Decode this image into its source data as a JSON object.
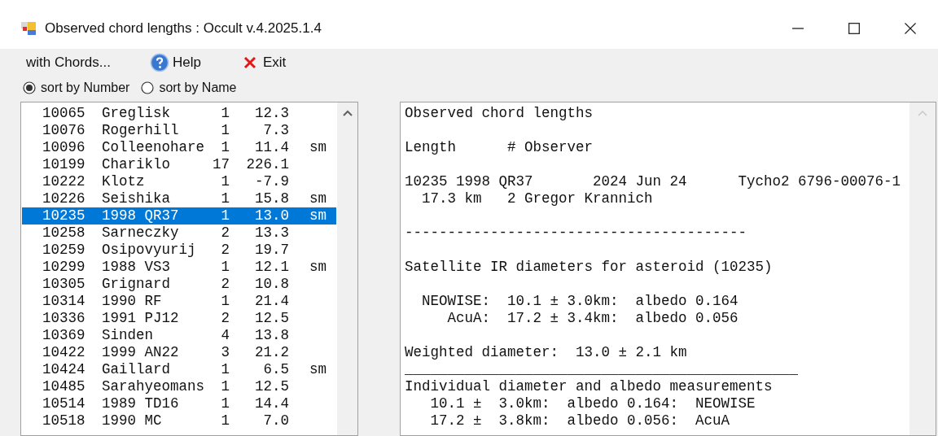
{
  "window": {
    "title": "Observed chord lengths : Occult v.4.2025.1.4"
  },
  "menu": [
    {
      "label": "with Chords...",
      "kind": "plain"
    },
    {
      "label": "Help",
      "kind": "help"
    },
    {
      "label": "Exit",
      "kind": "exit"
    }
  ],
  "sort_options": [
    {
      "label": "sort by Number",
      "selected": true
    },
    {
      "label": "sort by Name",
      "selected": false
    }
  ],
  "asteroid_list": [
    {
      "number": "10065",
      "name": "Greglisk",
      "count": "1",
      "value": "12.3",
      "selected": false
    },
    {
      "number": "10076",
      "name": "Rogerhill",
      "count": "1",
      "value": "7.3",
      "selected": false
    },
    {
      "number": "10096",
      "name": "Colleenohare",
      "count": "1",
      "value": "11.4",
      "flag": "sm",
      "selected": false
    },
    {
      "number": "10199",
      "name": "Chariklo",
      "count": "17",
      "value": "226.1",
      "selected": false
    },
    {
      "number": "10222",
      "name": "Klotz",
      "count": "1",
      "value": "-7.9",
      "selected": false
    },
    {
      "number": "10226",
      "name": "Seishika",
      "count": "1",
      "value": "15.8",
      "flag": "sm",
      "selected": false
    },
    {
      "number": "10235",
      "name": "1998 QR37",
      "count": "1",
      "value": "13.0",
      "flag": "sm",
      "selected": true
    },
    {
      "number": "10258",
      "name": "Sarneczky",
      "count": "2",
      "value": "13.3",
      "selected": false
    },
    {
      "number": "10259",
      "name": "Osipovyurij",
      "count": "2",
      "value": "19.7",
      "selected": false
    },
    {
      "number": "10299",
      "name": "1988 VS3",
      "count": "1",
      "value": "12.1",
      "flag": "sm",
      "selected": false
    },
    {
      "number": "10305",
      "name": "Grignard",
      "count": "2",
      "value": "10.8",
      "selected": false
    },
    {
      "number": "10314",
      "name": "1990 RF",
      "count": "1",
      "value": "21.4",
      "selected": false
    },
    {
      "number": "10336",
      "name": "1991 PJ12",
      "count": "2",
      "value": "12.5",
      "selected": false
    },
    {
      "number": "10369",
      "name": "Sinden",
      "count": "4",
      "value": "13.8",
      "selected": false
    },
    {
      "number": "10422",
      "name": "1999 AN22",
      "count": "3",
      "value": "21.2",
      "selected": false
    },
    {
      "number": "10424",
      "name": "Gaillard",
      "count": "1",
      "value": "6.5",
      "flag": "sm",
      "selected": false
    },
    {
      "number": "10485",
      "name": "Sarahyeomans",
      "count": "1",
      "value": "12.5",
      "selected": false
    },
    {
      "number": "10514",
      "name": "1989 TD16",
      "count": "1",
      "value": "14.4",
      "selected": false
    },
    {
      "number": "10518",
      "name": "1990 MC",
      "count": "1",
      "value": "7.0",
      "selected": false
    }
  ],
  "report": {
    "blocks": [
      [
        "Observed chord lengths"
      ],
      [
        "Length      # Observer"
      ],
      [
        "10235 1998 QR37       2024 Jun 24      Tycho2 6796-00076-1",
        "  17.3 km   2 Gregor Krannich"
      ],
      [
        "----------------------------------------"
      ],
      [
        "Satellite IR diameters for asteroid (10235)"
      ],
      [
        "  NEOWISE:  10.1 ± 3.0km:  albedo 0.164",
        "     AcuA:  17.2 ± 3.4km:  albedo 0.056"
      ],
      [
        "Weighted diameter:  13.0 ± 2.1 km",
        "______________________________________________",
        "Individual diameter and albedo measurements",
        "   10.1 ±  3.0km:  albedo 0.164:  NEOWISE",
        "   17.2 ±  3.8km:  albedo 0.056:  AcuA"
      ]
    ]
  }
}
